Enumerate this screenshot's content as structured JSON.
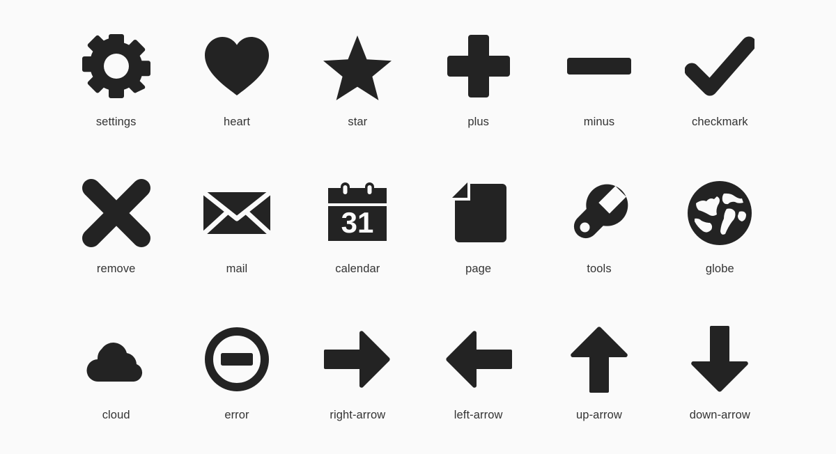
{
  "page": {
    "background_color": "#fafafa",
    "icon_color": "#232323",
    "label_color": "#333333",
    "columns": 6,
    "rows": 3,
    "icon_count": 18
  },
  "grid": {
    "items": [
      {
        "label": "settings",
        "icon": "gear-icon"
      },
      {
        "label": "heart",
        "icon": "heart-icon"
      },
      {
        "label": "star",
        "icon": "star-icon"
      },
      {
        "label": "plus",
        "icon": "plus-icon"
      },
      {
        "label": "minus",
        "icon": "minus-icon"
      },
      {
        "label": "checkmark",
        "icon": "checkmark-icon"
      },
      {
        "label": "remove",
        "icon": "x-cross-icon"
      },
      {
        "label": "mail",
        "icon": "envelope-icon"
      },
      {
        "label": "calendar",
        "icon": "calendar-icon",
        "day_number": "31"
      },
      {
        "label": "page",
        "icon": "page-icon"
      },
      {
        "label": "tools",
        "icon": "wrench-icon"
      },
      {
        "label": "globe",
        "icon": "globe-icon"
      },
      {
        "label": "cloud",
        "icon": "cloud-icon"
      },
      {
        "label": "error",
        "icon": "minus-circle-icon"
      },
      {
        "label": "right-arrow",
        "icon": "arrow-right-icon"
      },
      {
        "label": "left-arrow",
        "icon": "arrow-left-icon"
      },
      {
        "label": "up-arrow",
        "icon": "arrow-up-icon"
      },
      {
        "label": "down-arrow",
        "icon": "arrow-down-icon"
      }
    ]
  }
}
